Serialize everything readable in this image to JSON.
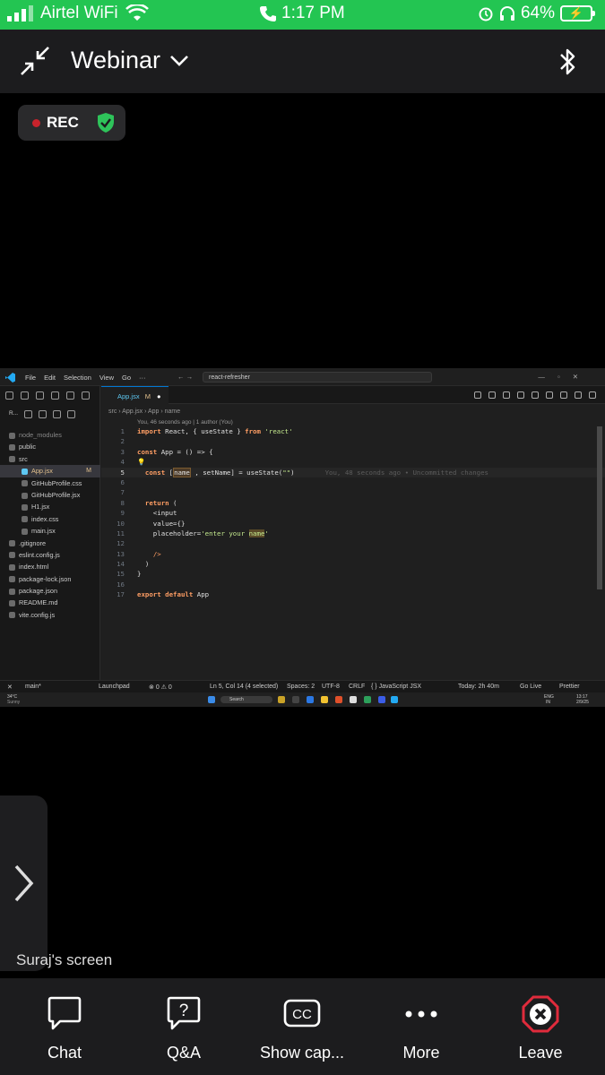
{
  "status_bar": {
    "carrier": "Airtel WiFi",
    "time": "1:17 PM",
    "battery": "64%"
  },
  "header": {
    "title": "Webinar"
  },
  "rec": {
    "label": "REC"
  },
  "shared_screen": {
    "window_search": "react-refresher",
    "menu": [
      "File",
      "Edit",
      "Selection",
      "View",
      "Go",
      "···"
    ],
    "tab_label": "App.jsx",
    "tab_badge": "M",
    "breadcrumb": "src  ›  App.jsx  ›  App  ›  name",
    "blame": "You, 46 seconds ago | 1 author (You)",
    "inline_blame": "You, 48 seconds ago • Uncommitted changes",
    "explorer_label": "R...",
    "tree": [
      {
        "label": "node_modules",
        "indent": 1,
        "color": "#888"
      },
      {
        "label": "public",
        "indent": 1,
        "color": "#ccc"
      },
      {
        "label": "src",
        "indent": 1,
        "color": "#ccc"
      },
      {
        "label": "App.jsx",
        "indent": 2,
        "color": "#e2c08d",
        "badge": "M",
        "sel": true
      },
      {
        "label": "GitHubProfile.css",
        "indent": 2,
        "color": "#ccc"
      },
      {
        "label": "GitHubProfile.jsx",
        "indent": 2,
        "color": "#ccc"
      },
      {
        "label": "H1.jsx",
        "indent": 2,
        "color": "#ccc"
      },
      {
        "label": "index.css",
        "indent": 2,
        "color": "#ccc"
      },
      {
        "label": "main.jsx",
        "indent": 2,
        "color": "#ccc"
      },
      {
        "label": ".gitignore",
        "indent": 1,
        "color": "#ccc"
      },
      {
        "label": "eslint.config.js",
        "indent": 1,
        "color": "#ccc"
      },
      {
        "label": "index.html",
        "indent": 1,
        "color": "#ccc"
      },
      {
        "label": "package-lock.json",
        "indent": 1,
        "color": "#ccc"
      },
      {
        "label": "package.json",
        "indent": 1,
        "color": "#ccc"
      },
      {
        "label": "README.md",
        "indent": 1,
        "color": "#ccc"
      },
      {
        "label": "vite.config.js",
        "indent": 1,
        "color": "#ccc"
      }
    ],
    "code_lines": [
      "1",
      "2",
      "3",
      "4",
      "5",
      "6",
      "7",
      "8",
      "9",
      "10",
      "11",
      "12",
      "13",
      "14",
      "15",
      "16",
      "17"
    ],
    "status": {
      "branch": "main*",
      "launchpad": "Launchpad",
      "errors": "0 ⚠ 0",
      "position": "Ln 5, Col 14 (4 selected)",
      "spaces": "Spaces: 2",
      "encoding": "UTF-8",
      "eol": "CRLF",
      "language": "{ } JavaScript JSX",
      "today": "Today: 2h 40m",
      "golive": "Go Live",
      "prettier": "Prettier"
    },
    "taskbar": {
      "weather": "34°C",
      "weather_sub": "Sunny",
      "search": "Search",
      "lang": "ENG",
      "lang_sub": "IN",
      "clock": "13:17",
      "date": "2/9/25"
    }
  },
  "screen_owner": "Suraj's screen",
  "toolbar": {
    "chat": "Chat",
    "qa": "Q&A",
    "captions": "Show cap...",
    "more": "More",
    "leave": "Leave"
  },
  "colors": {
    "status_bar_bg": "#23c552",
    "leave_red": "#e02b3c",
    "rec_red": "#c8232c",
    "shield_green": "#2ec35a"
  }
}
